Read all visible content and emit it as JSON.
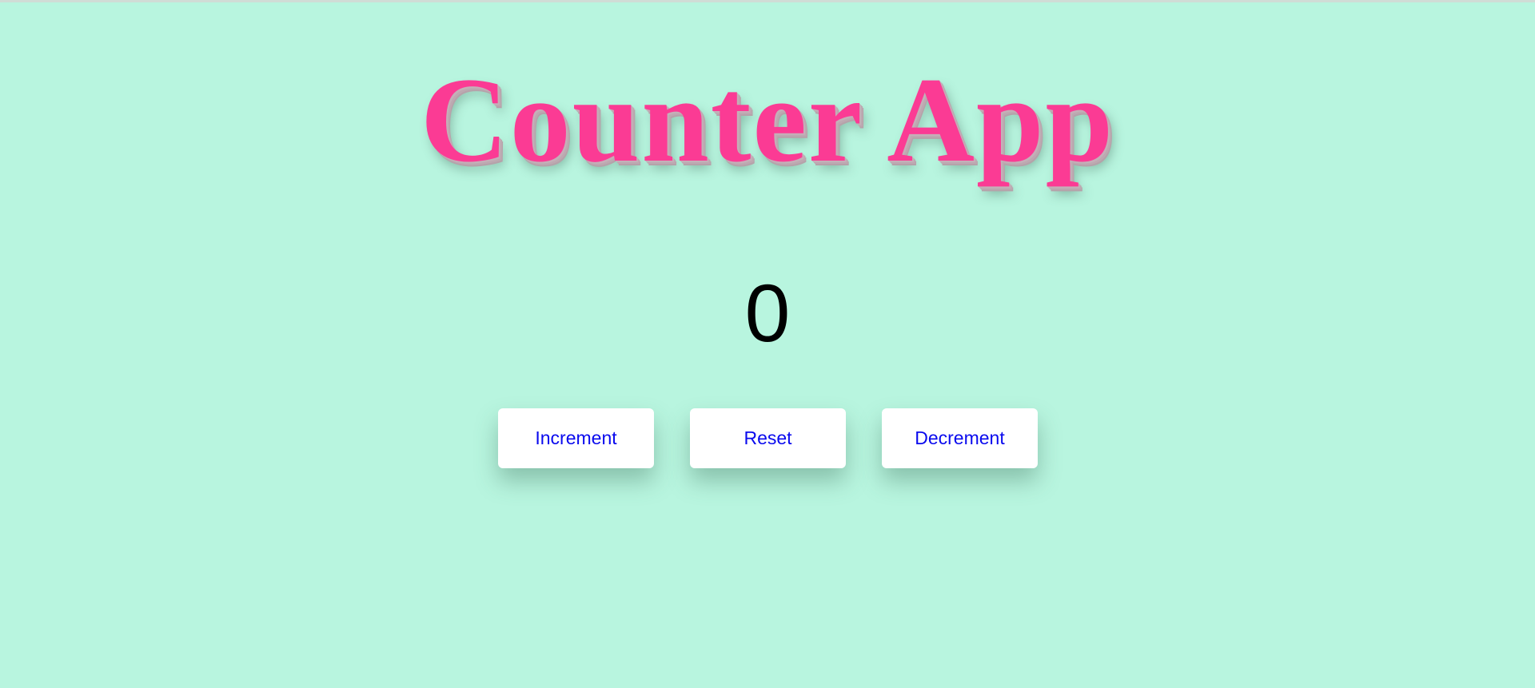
{
  "app": {
    "title": "Counter App",
    "count": "0"
  },
  "buttons": {
    "increment_label": "Increment",
    "reset_label": "Reset",
    "decrement_label": "Decrement"
  },
  "colors": {
    "background": "#b8f5df",
    "title": "#fb3b94",
    "count": "#000000",
    "button_background": "#ffffff",
    "button_text": "#0a0aee"
  }
}
